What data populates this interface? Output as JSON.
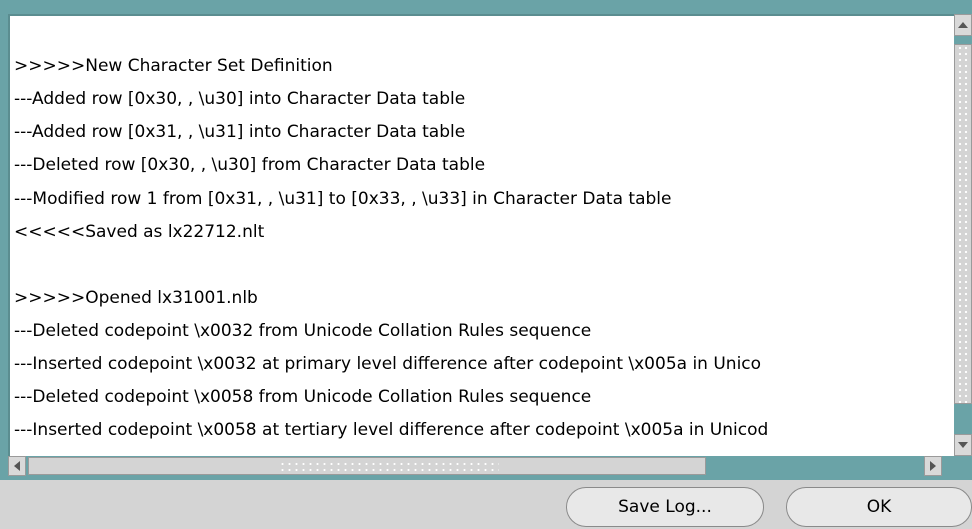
{
  "log": {
    "lines": [
      "",
      ">>>>>New Character Set Definition",
      "---Added row [0x30, , \\u30] into Character Data table",
      "---Added row [0x31, , \\u31] into Character Data table",
      "---Deleted row [0x30, , \\u30] from Character Data table",
      "---Modified row 1 from [0x31, , \\u31] to [0x33, , \\u33] in Character Data table",
      "<<<<<Saved as lx22712.nlt",
      "",
      ">>>>>Opened lx31001.nlb",
      "---Deleted codepoint \\x0032 from Unicode Collation Rules sequence",
      "---Inserted codepoint \\x0032 at primary level difference after codepoint \\x005a in Unico",
      "---Deleted codepoint \\x0058 from Unicode Collation Rules sequence",
      "---Inserted codepoint \\x0058 at tertiary level difference after codepoint \\x005a in Unicod"
    ]
  },
  "icons": {
    "up": "up-arrow-icon",
    "down": "down-arrow-icon",
    "left": "left-arrow-icon",
    "right": "right-arrow-icon"
  },
  "buttons": {
    "save_log": "Save Log...",
    "ok": "OK"
  },
  "colors": {
    "frame": "#6aa3a7",
    "log_background": "#ffffff",
    "dialog_background": "#d4d4d4"
  }
}
